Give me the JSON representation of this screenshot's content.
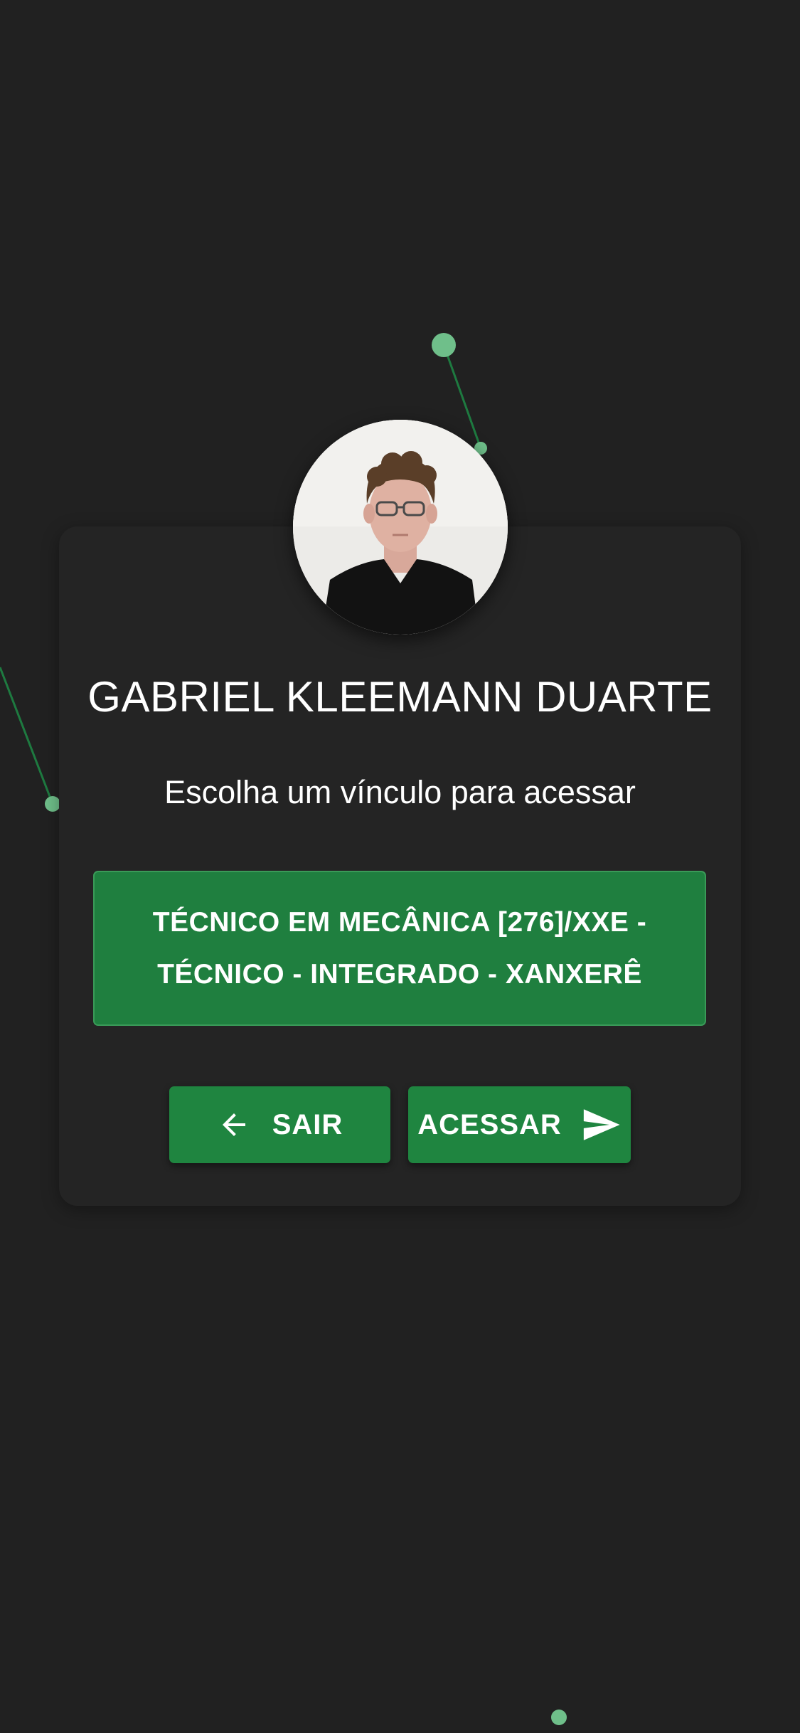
{
  "user": {
    "name": "GABRIEL KLEEMANN DUARTE"
  },
  "prompt": {
    "text": "Escolha um vínculo para acessar"
  },
  "links": [
    {
      "label": "TÉCNICO EM MECÂNICA [276]/XXE - TÉCNICO - INTEGRADO - XANXERÊ"
    }
  ],
  "actions": {
    "logout_label": "SAIR",
    "logout_icon": "arrow-left-icon",
    "access_label": "ACESSAR",
    "access_icon": "send-icon"
  },
  "colors": {
    "background": "#212121",
    "card": "#242424",
    "accent": "#1f8540",
    "particle": "#6fbf8a"
  }
}
